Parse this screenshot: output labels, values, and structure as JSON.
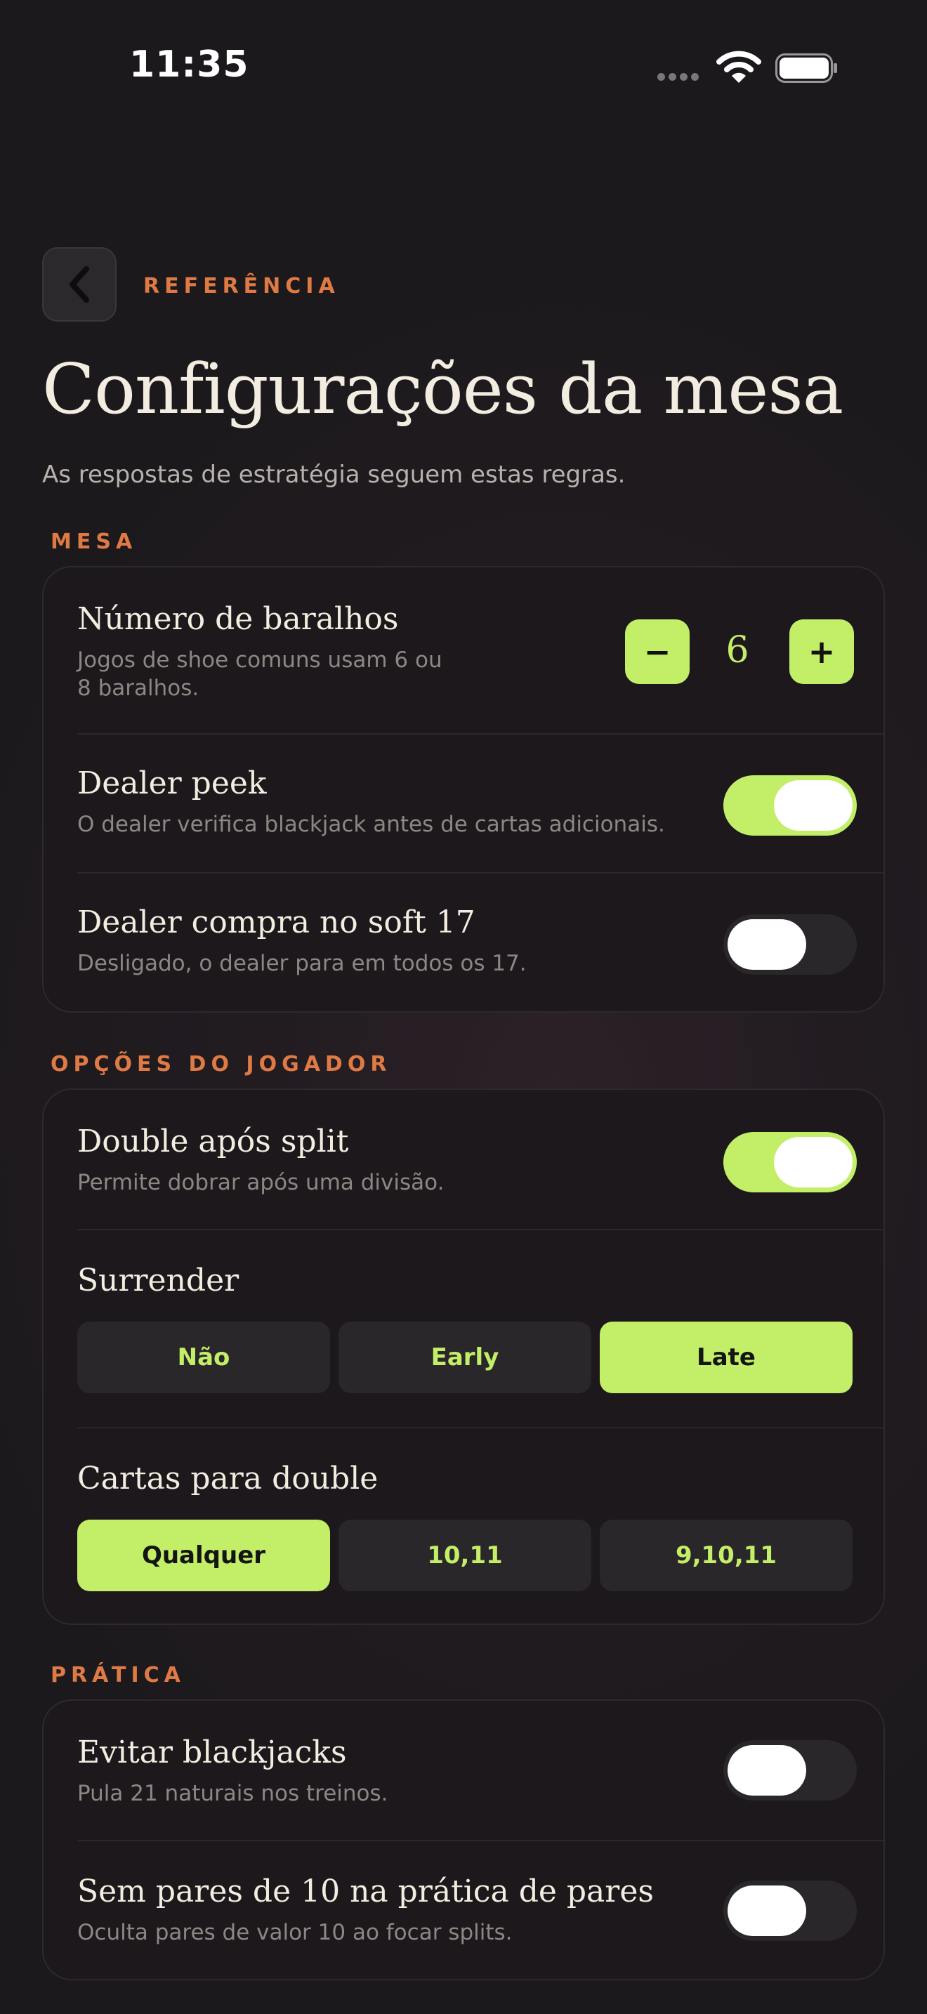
{
  "status_bar": {
    "time": "11:35"
  },
  "header": {
    "eyebrow": "REFERÊNCIA",
    "title": "Configurações da mesa",
    "subtitle": "As respostas de estratégia seguem estas regras."
  },
  "sections": {
    "mesa": {
      "label": "MESA",
      "decks": {
        "title": "Número de baralhos",
        "desc_line1": "Jogos de shoe comuns usam 6 ou",
        "desc_line2": "8 baralhos.",
        "value": "6",
        "minus": "−",
        "plus": "+"
      },
      "dealer_peek": {
        "title": "Dealer peek",
        "desc": "O dealer verifica blackjack antes de cartas adicionais.",
        "on": true
      },
      "soft17": {
        "title": "Dealer compra no soft 17",
        "desc": "Desligado, o dealer para em todos os 17.",
        "on": false
      }
    },
    "jogador": {
      "label": "OPÇÕES DO JOGADOR",
      "das": {
        "title": "Double após split",
        "desc": "Permite dobrar após uma divisão.",
        "on": true
      },
      "surrender": {
        "title": "Surrender",
        "options": [
          "Não",
          "Early",
          "Late"
        ],
        "selected": "Late"
      },
      "double_cards": {
        "title": "Cartas para double",
        "options": [
          "Qualquer",
          "10,11",
          "9,10,11"
        ],
        "selected": "Qualquer"
      }
    },
    "pratica": {
      "label": "PRÁTICA",
      "avoid_bj": {
        "title": "Evitar blackjacks",
        "desc": "Pula 21 naturais nos treinos.",
        "on": false
      },
      "no_ten_pairs": {
        "title": "Sem pares de 10 na prática de pares",
        "desc": "Oculta pares de valor 10 ao focar splits.",
        "on": false
      }
    }
  },
  "colors": {
    "accent": "#c3ee67",
    "label": "#e07a45",
    "background": "#1f1a1e"
  }
}
